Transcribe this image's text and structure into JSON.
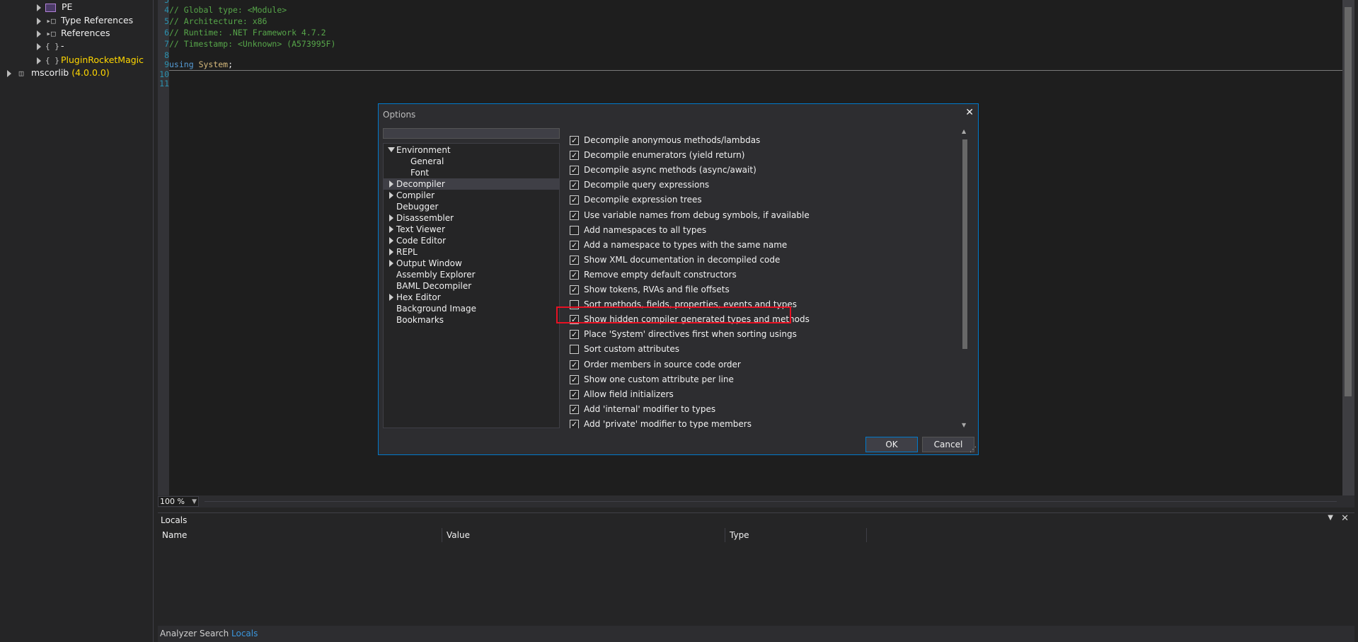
{
  "tree": {
    "items": [
      {
        "label": "PE",
        "icon": "pe-icon"
      },
      {
        "label": "Type References",
        "icon": "type-references-icon"
      },
      {
        "label": "References",
        "icon": "references-icon"
      },
      {
        "label": "-",
        "icon": "namespace-icon",
        "glyph": "{ }"
      },
      {
        "label": "PluginRocketMagic",
        "icon": "namespace-icon",
        "glyph": "{ }",
        "color": "#ffd700"
      }
    ],
    "assembly": {
      "name": "mscorlib",
      "version": "(4.0.0.0)"
    }
  },
  "editor": {
    "lines": [
      {
        "num": "5",
        "text": ""
      },
      {
        "num": "4",
        "text": "// Global type: <Module>"
      },
      {
        "num": "5",
        "text": "// Architecture: x86"
      },
      {
        "num": "6",
        "text": "// Runtime: .NET Framework 4.7.2"
      },
      {
        "num": "7",
        "text": "// Timestamp: <Unknown> (A573995F)"
      },
      {
        "num": "8",
        "text": ""
      },
      {
        "num": "9",
        "using": "using",
        "ns": "System",
        "end": ";"
      },
      {
        "num": "10",
        "text": ""
      },
      {
        "num": "11",
        "text": ""
      }
    ],
    "zoom": "100 %"
  },
  "locals": {
    "title": "Locals",
    "columns": [
      "Name",
      "Value",
      "Type"
    ]
  },
  "bottom_tabs": [
    "Analyzer",
    "Search",
    "Locals"
  ],
  "dialog": {
    "title": "Options",
    "close_glyph": "✕",
    "search_placeholder": "",
    "nav": [
      {
        "label": "Environment",
        "expander": "open",
        "indent": 0
      },
      {
        "label": "General",
        "expander": "none",
        "indent": 1
      },
      {
        "label": "Font",
        "expander": "none",
        "indent": 1
      },
      {
        "label": "Decompiler",
        "expander": "closed",
        "indent": 0,
        "selected": true
      },
      {
        "label": "Compiler",
        "expander": "closed",
        "indent": 0
      },
      {
        "label": "Debugger",
        "expander": "none",
        "indent": 0
      },
      {
        "label": "Disassembler",
        "expander": "closed",
        "indent": 0
      },
      {
        "label": "Text Viewer",
        "expander": "closed",
        "indent": 0
      },
      {
        "label": "Code Editor",
        "expander": "closed",
        "indent": 0
      },
      {
        "label": "REPL",
        "expander": "closed",
        "indent": 0
      },
      {
        "label": "Output Window",
        "expander": "closed",
        "indent": 0
      },
      {
        "label": "Assembly Explorer",
        "expander": "none",
        "indent": 0
      },
      {
        "label": "BAML Decompiler",
        "expander": "none",
        "indent": 0
      },
      {
        "label": "Hex Editor",
        "expander": "closed",
        "indent": 0
      },
      {
        "label": "Background Image",
        "expander": "none",
        "indent": 0
      },
      {
        "label": "Bookmarks",
        "expander": "none",
        "indent": 0
      }
    ],
    "options": [
      {
        "label": "Decompile anonymous methods/lambdas",
        "checked": true
      },
      {
        "label": "Decompile enumerators (yield return)",
        "checked": true
      },
      {
        "label": "Decompile async methods (async/await)",
        "checked": true
      },
      {
        "label": "Decompile query expressions",
        "checked": true
      },
      {
        "label": "Decompile expression trees",
        "checked": true
      },
      {
        "label": "Use variable names from debug symbols, if available",
        "checked": true
      },
      {
        "label": "Add namespaces to all types",
        "checked": false
      },
      {
        "label": "Add a namespace to types with the same name",
        "checked": true
      },
      {
        "label": "Show XML documentation in decompiled code",
        "checked": true
      },
      {
        "label": "Remove empty default constructors",
        "checked": true
      },
      {
        "label": "Show tokens, RVAs and file offsets",
        "checked": true
      },
      {
        "label": "Sort methods, fields, properties, events and types",
        "checked": false
      },
      {
        "label": "Show hidden compiler generated types and methods",
        "checked": true,
        "highlighted": true
      },
      {
        "label": "Place 'System' directives first when sorting usings",
        "checked": true
      },
      {
        "label": "Sort custom attributes",
        "checked": false
      },
      {
        "label": "Order members in source code order",
        "checked": true
      },
      {
        "label": "Show one custom attribute per line",
        "checked": true
      },
      {
        "label": "Allow field initializers",
        "checked": true
      },
      {
        "label": "Add 'internal' modifier to types",
        "checked": true
      },
      {
        "label": "Add 'private' modifier to type members",
        "checked": true
      }
    ],
    "ok_label": "OK",
    "cancel_label": "Cancel",
    "highlight_color": "#e81123",
    "accent_color": "#007acc"
  }
}
